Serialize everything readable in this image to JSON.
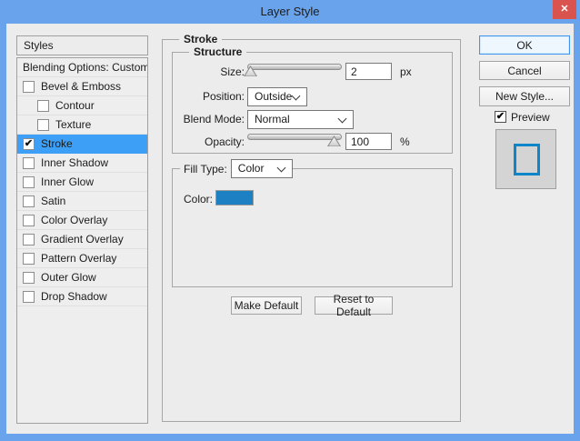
{
  "window": {
    "title": "Layer Style",
    "close_glyph": "✕"
  },
  "colors": {
    "titlebar_blue": "#69a3ec",
    "selection_blue": "#3d9ff5",
    "close_red": "#d9534f",
    "ok_border_blue": "#3e97ef",
    "swatch_blue": "#1d80c2",
    "preview_stroke_blue": "#0d86c9"
  },
  "styles_panel": {
    "header": "Styles",
    "items": [
      {
        "label": "Blending Options: Custom",
        "checkbox": false,
        "checked": false,
        "indent": false,
        "selected": false
      },
      {
        "label": "Bevel & Emboss",
        "checkbox": true,
        "checked": false,
        "indent": false,
        "selected": false
      },
      {
        "label": "Contour",
        "checkbox": true,
        "checked": false,
        "indent": true,
        "selected": false
      },
      {
        "label": "Texture",
        "checkbox": true,
        "checked": false,
        "indent": true,
        "selected": false
      },
      {
        "label": "Stroke",
        "checkbox": true,
        "checked": true,
        "indent": false,
        "selected": true
      },
      {
        "label": "Inner Shadow",
        "checkbox": true,
        "checked": false,
        "indent": false,
        "selected": false
      },
      {
        "label": "Inner Glow",
        "checkbox": true,
        "checked": false,
        "indent": false,
        "selected": false
      },
      {
        "label": "Satin",
        "checkbox": true,
        "checked": false,
        "indent": false,
        "selected": false
      },
      {
        "label": "Color Overlay",
        "checkbox": true,
        "checked": false,
        "indent": false,
        "selected": false
      },
      {
        "label": "Gradient Overlay",
        "checkbox": true,
        "checked": false,
        "indent": false,
        "selected": false
      },
      {
        "label": "Pattern Overlay",
        "checkbox": true,
        "checked": false,
        "indent": false,
        "selected": false
      },
      {
        "label": "Outer Glow",
        "checkbox": true,
        "checked": false,
        "indent": false,
        "selected": false
      },
      {
        "label": "Drop Shadow",
        "checkbox": true,
        "checked": false,
        "indent": false,
        "selected": false
      }
    ]
  },
  "stroke_panel": {
    "title": "Stroke",
    "structure": {
      "title": "Structure",
      "size_label": "Size:",
      "size_value": "2",
      "size_unit": "px",
      "position_label": "Position:",
      "position_value": "Outside",
      "blend_mode_label": "Blend Mode:",
      "blend_mode_value": "Normal",
      "opacity_label": "Opacity:",
      "opacity_value": "100",
      "opacity_unit": "%"
    },
    "fill": {
      "type_label": "Fill Type:",
      "type_value": "Color",
      "color_label": "Color:",
      "color_hex": "#1d80c2"
    },
    "footer_buttons": {
      "make_default": "Make Default",
      "reset_to_default": "Reset to Default"
    }
  },
  "action_buttons": {
    "ok": "OK",
    "cancel": "Cancel",
    "new_style": "New Style..."
  },
  "preview": {
    "label": "Preview",
    "checked": true
  }
}
